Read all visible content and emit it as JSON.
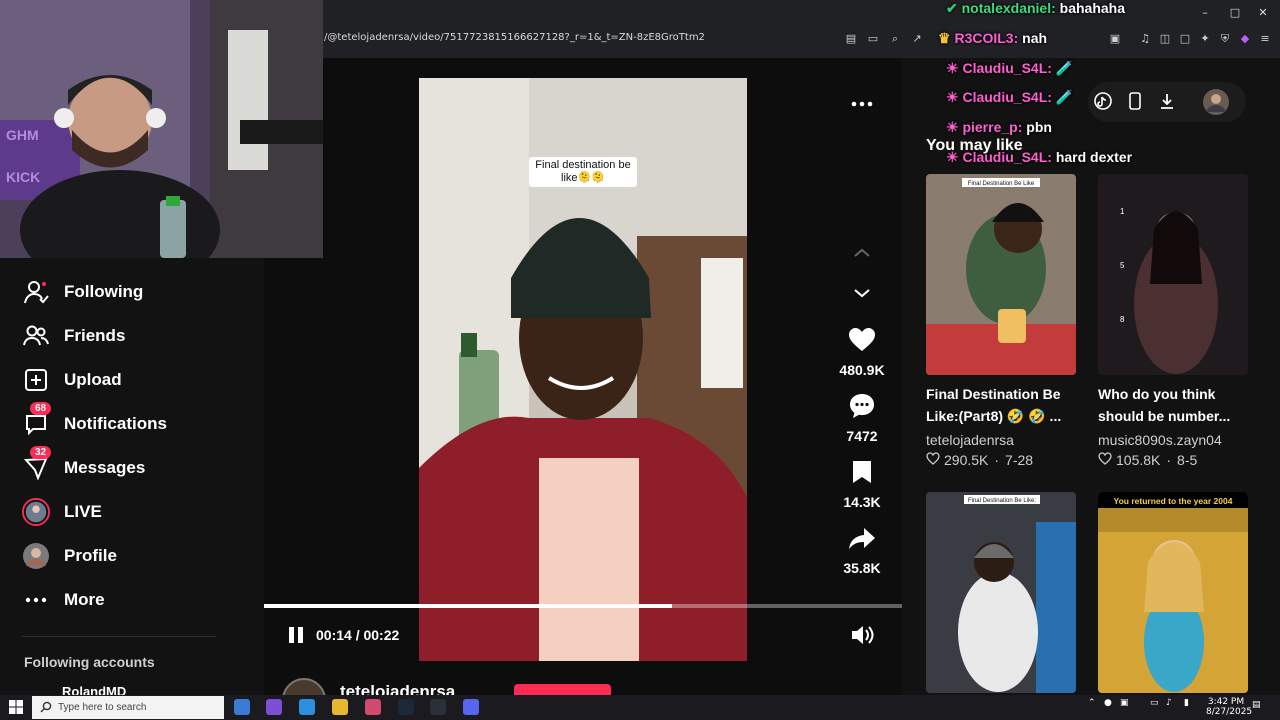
{
  "browser": {
    "address": "/@tetelojadenrsa/video/7517723815166627128?_r=1&_t=ZN-8zE8GroTtm2"
  },
  "sidebar": {
    "items": [
      {
        "label": "Following",
        "icon": "following-icon"
      },
      {
        "label": "Friends",
        "icon": "friends-icon"
      },
      {
        "label": "Upload",
        "icon": "upload-icon"
      },
      {
        "label": "Notifications",
        "icon": "notifications-icon",
        "badge": "68"
      },
      {
        "label": "Messages",
        "icon": "messages-icon",
        "badge": "32"
      },
      {
        "label": "LIVE",
        "icon": "live-icon"
      },
      {
        "label": "Profile",
        "icon": "profile-icon"
      },
      {
        "label": "More",
        "icon": "more-icon"
      }
    ],
    "following_accounts_header": "Following accounts",
    "following_accounts": [
      "RolandMD"
    ]
  },
  "video": {
    "caption_overlay": "Final destination be like🫠🫠",
    "time": "00:14 / 00:22",
    "progress": 0.64,
    "author": "tetelojadenrsa"
  },
  "actions": {
    "likes": "480.9K",
    "comments": "7472",
    "saves": "14.3K",
    "shares": "35.8K"
  },
  "recommendations": {
    "header": "You may like",
    "cards": [
      {
        "title": "Final Destination Be Like:(Part8) 🤣 🤣 ...",
        "author": "tetelojadenrsa",
        "likes": "290.5K",
        "date": "7-28",
        "thumb_text": "Final Destination Be Like"
      },
      {
        "title": "Who do you think should be number...",
        "author": "music8090s.zayn04",
        "likes": "105.8K",
        "date": "8-5",
        "thumb_text": ""
      },
      {
        "title": "",
        "author": "",
        "likes": "",
        "date": "",
        "thumb_text": "Final Destination Be Like:"
      },
      {
        "title": "",
        "author": "",
        "likes": "",
        "date": "",
        "thumb_text": "You returned to the year 2004"
      }
    ]
  },
  "chat": [
    {
      "user": "notalexdaniel:",
      "message": "bahahaha"
    },
    {
      "user": "R3COIL3:",
      "message": "nah"
    },
    {
      "user": "Claudiu_S4L:",
      "message": "🧪"
    },
    {
      "user": "Claudiu_S4L:",
      "message": "🧪"
    },
    {
      "user": "pierre_p:",
      "message": "pbn"
    },
    {
      "user": "Claudiu_S4L:",
      "message": "hard dexter"
    }
  ],
  "taskbar": {
    "search_placeholder": "Type here to search",
    "time": "3:42 PM",
    "date": "8/27/2025"
  },
  "colors": {
    "accent": "#fe2c55",
    "chat_user": "#ff5fd2"
  }
}
